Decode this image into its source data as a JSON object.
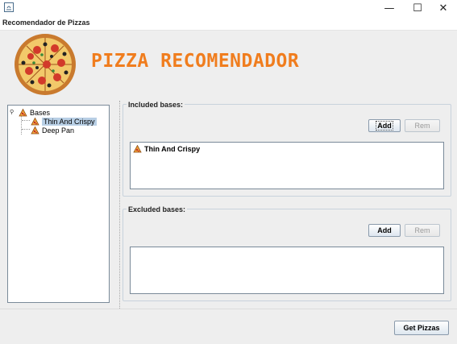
{
  "window": {
    "title": "Recomendador de Pizzas",
    "controls": {
      "minimize": "—",
      "maximize": "☐",
      "close": "✕"
    }
  },
  "banner": {
    "title": "PIZZA RECOMENDADOR"
  },
  "tree": {
    "root": "Bases",
    "children": [
      "Thin And Crispy",
      "Deep Pan"
    ],
    "selected": "Thin And Crispy"
  },
  "included": {
    "title": "Included bases:",
    "add_label": "Add",
    "rem_label": "Rem",
    "items": [
      "Thin And Crispy"
    ]
  },
  "excluded": {
    "title": "Excluded bases:",
    "add_label": "Add",
    "rem_label": "Rem",
    "items": []
  },
  "footer": {
    "get_pizzas_label": "Get Pizzas"
  },
  "colors": {
    "accent": "#f07d1e",
    "selection": "#b8cfe5"
  }
}
